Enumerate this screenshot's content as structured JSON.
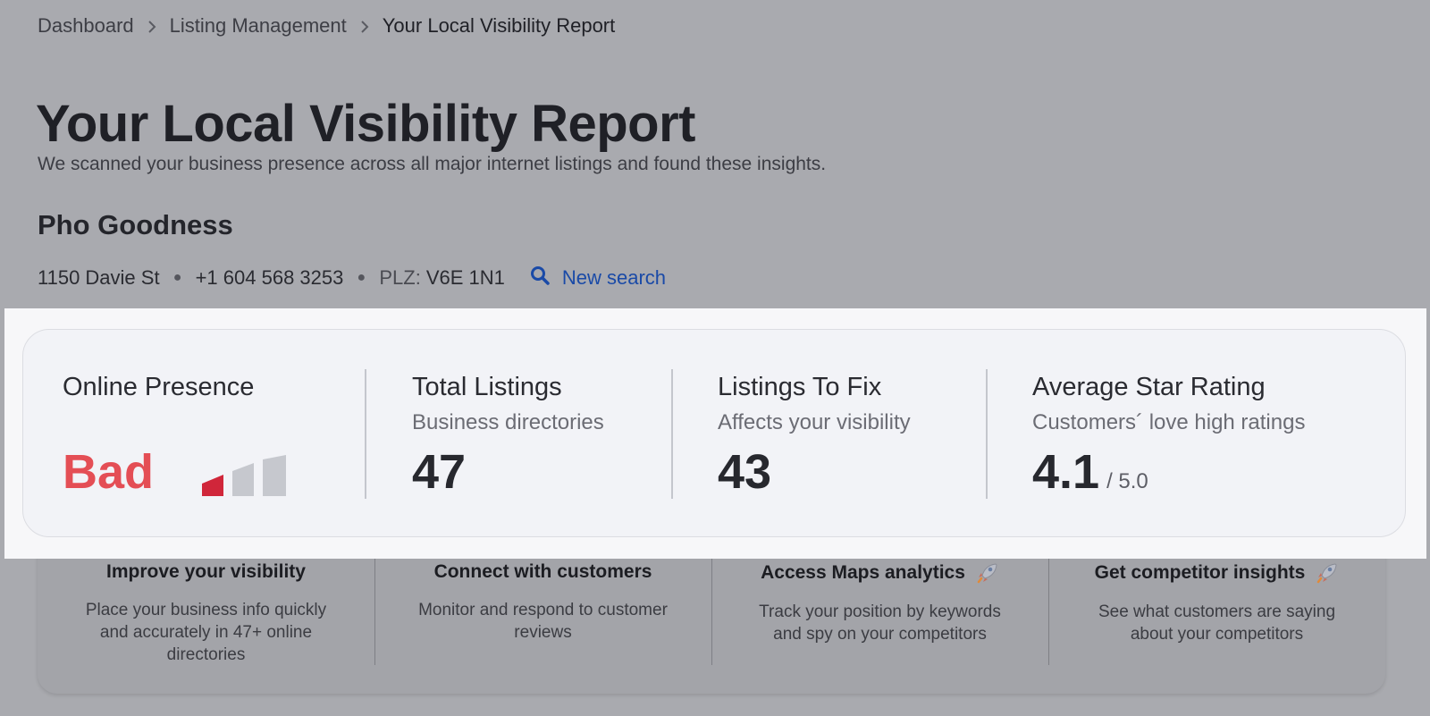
{
  "breadcrumb": {
    "items": [
      "Dashboard",
      "Listing Management",
      "Your Local Visibility Report"
    ]
  },
  "header": {
    "title": "Your Local Visibility Report",
    "subtitle": "We scanned your business presence across all major internet listings and found these insights."
  },
  "business": {
    "name": "Pho Goodness",
    "address": "1150 Davie St",
    "phone": "+1 604 568 3253",
    "plz_label": "PLZ:",
    "plz_value": "V6E 1N1",
    "new_search_label": "New search"
  },
  "stats": {
    "online_presence": {
      "title": "Online Presence",
      "value": "Bad",
      "level": 1,
      "max_level": 3,
      "color": "#e44e55"
    },
    "total_listings": {
      "title": "Total Listings",
      "subtitle": "Business directories",
      "value": "47"
    },
    "listings_to_fix": {
      "title": "Listings To Fix",
      "subtitle": "Affects your visibility",
      "value": "43"
    },
    "average_rating": {
      "title": "Average Star Rating",
      "subtitle": "Customers´ love high ratings",
      "value": "4.1",
      "out_of": "/ 5.0"
    }
  },
  "features": [
    {
      "title": "Improve your visibility",
      "description": "Place your business info quickly and accurately in 47+ online directories",
      "icon": ""
    },
    {
      "title": "Connect with customers",
      "description": "Monitor and respond to customer reviews",
      "icon": ""
    },
    {
      "title": "Access Maps analytics",
      "description": "Track your position by keywords and spy on your competitors",
      "icon": "rocket-icon"
    },
    {
      "title": "Get competitor insights",
      "description": "See what customers are saying about your competitors",
      "icon": "rocket-icon"
    }
  ],
  "colors": {
    "accent_link": "#1a4aa7",
    "bad": "#e44e55",
    "signal_active": "#d0263a",
    "signal_inactive": "#c6c8ce"
  }
}
